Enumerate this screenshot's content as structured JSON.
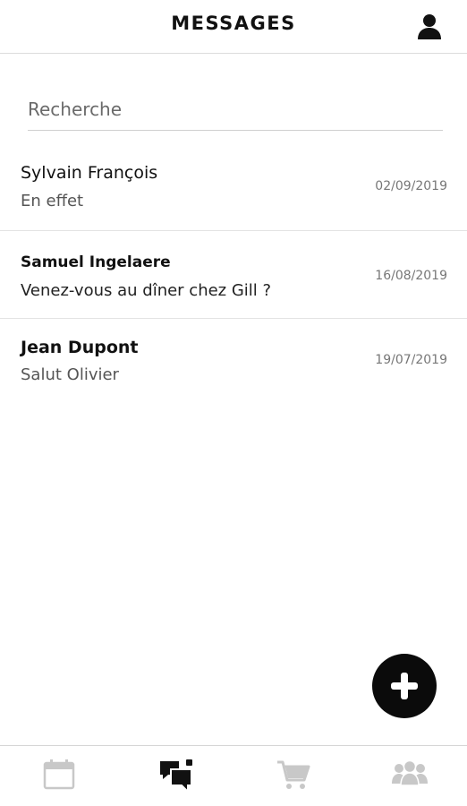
{
  "header": {
    "title": "MESSAGES"
  },
  "search": {
    "placeholder": "Recherche"
  },
  "conversations": [
    {
      "name": "Sylvain François",
      "preview": "En effet",
      "date": "02/09/2019"
    },
    {
      "name": "Samuel Ingelaere",
      "preview": "Venez-vous au dîner chez Gill ?",
      "date": "16/08/2019"
    },
    {
      "name": "Jean Dupont",
      "preview": "Salut Olivier",
      "date": "19/07/2019"
    }
  ],
  "fab": {
    "icon": "plus-icon"
  },
  "bottom_nav": [
    {
      "icon": "calendar-icon",
      "active": false
    },
    {
      "icon": "chat-icon",
      "active": true
    },
    {
      "icon": "cart-icon",
      "active": false
    },
    {
      "icon": "group-icon",
      "active": false
    }
  ],
  "colors": {
    "accent": "#0b0b0b",
    "inactive_icon": "#c8c8c8",
    "divider": "#e3e3e3"
  }
}
